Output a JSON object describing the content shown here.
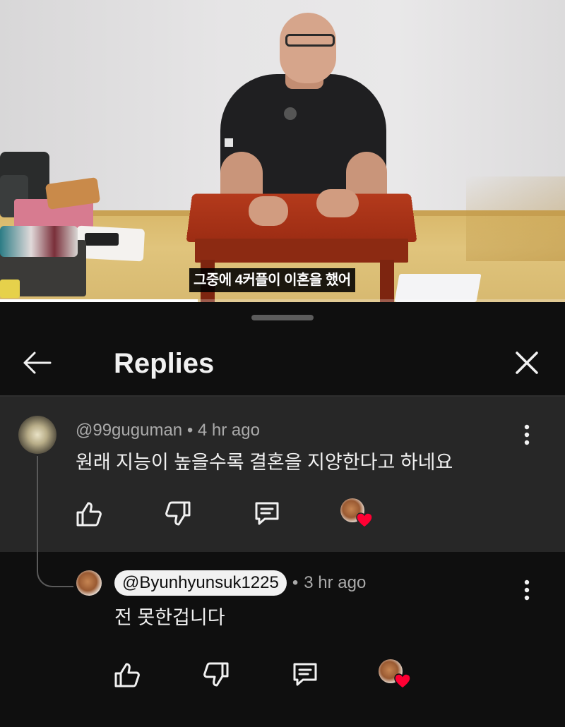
{
  "video": {
    "subtitle": "그중에 4커플이 이혼을 했어",
    "progress_fraction": 0.35
  },
  "sheet": {
    "title": "Replies",
    "back_icon": "arrow-left-icon",
    "close_icon": "close-icon"
  },
  "parent_comment": {
    "author": "@99guguman",
    "time": "4 hr ago",
    "separator": "•",
    "text": "원래 지능이 높을수록 결혼을 지양한다고 하네요",
    "actions": [
      "like-icon",
      "dislike-icon",
      "reply-icon",
      "creator-heart-icon"
    ]
  },
  "reply_comment": {
    "author": "@Byunhyunsuk1225",
    "time": "3 hr ago",
    "separator": "•",
    "text": "전 못한겁니다",
    "actions": [
      "like-icon",
      "dislike-icon",
      "reply-icon",
      "creator-heart-icon"
    ]
  },
  "colors": {
    "background": "#0f0f0f",
    "highlight_row": "#272727",
    "text_primary": "#f1f1f1",
    "text_secondary": "#aaaaaa",
    "heart": "#ff0033"
  }
}
